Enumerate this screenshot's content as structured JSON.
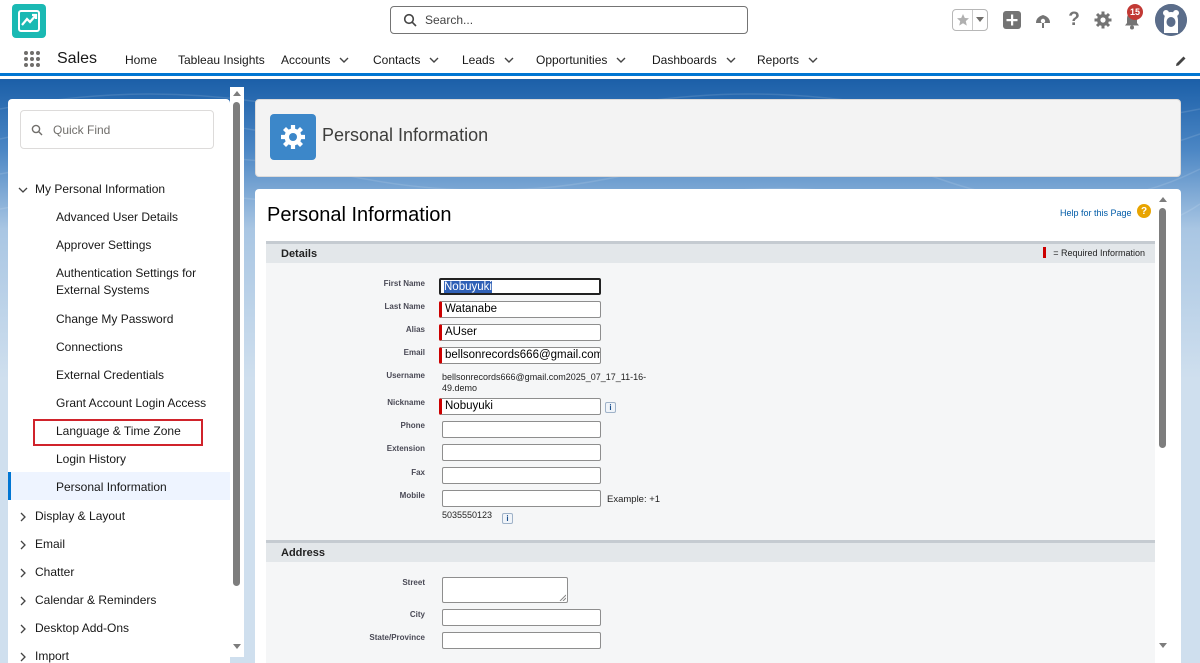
{
  "header": {
    "search_placeholder": "Search...",
    "notification_count": "15"
  },
  "nav": {
    "app_name": "Sales",
    "items": [
      {
        "label": "Home",
        "dropdown": false
      },
      {
        "label": "Tableau Insights",
        "dropdown": false
      },
      {
        "label": "Accounts",
        "dropdown": true
      },
      {
        "label": "Contacts",
        "dropdown": true
      },
      {
        "label": "Leads",
        "dropdown": true
      },
      {
        "label": "Opportunities",
        "dropdown": true
      },
      {
        "label": "Dashboards",
        "dropdown": true
      },
      {
        "label": "Reports",
        "dropdown": true
      }
    ]
  },
  "sidebar": {
    "quick_find_placeholder": "Quick Find",
    "section": "My Personal Information",
    "children": [
      "Advanced User Details",
      "Approver Settings",
      "Authentication Settings for External Systems",
      "Change My Password",
      "Connections",
      "External Credentials",
      "Grant Account Login Access",
      "Language & Time Zone",
      "Login History",
      "Personal Information"
    ],
    "collapsed_sections": [
      "Display & Layout",
      "Email",
      "Chatter",
      "Calendar & Reminders",
      "Desktop Add-Ons",
      "Import"
    ],
    "selected_item": "Personal Information",
    "highlighted_item": "Language & Time Zone"
  },
  "page_header": {
    "title": "Personal Information",
    "icon": "gear-icon"
  },
  "main": {
    "title": "Personal Information",
    "help_link": "Help for this Page",
    "details_section": {
      "title": "Details",
      "required_legend": "= Required Information",
      "fields": {
        "first_name": {
          "label": "First Name",
          "value": "Nobuyuki"
        },
        "last_name": {
          "label": "Last Name",
          "value": "Watanabe"
        },
        "alias": {
          "label": "Alias",
          "value": "AUser"
        },
        "email": {
          "label": "Email",
          "value": "bellsonrecords666@gmail.com"
        },
        "username": {
          "label": "Username",
          "value_line1": "bellsonrecords666@gmail.com2025_07_17_11-16-",
          "value_line2": "49.demo"
        },
        "nickname": {
          "label": "Nickname",
          "value": "Nobuyuki"
        },
        "phone": {
          "label": "Phone",
          "value": ""
        },
        "extension": {
          "label": "Extension",
          "value": ""
        },
        "fax": {
          "label": "Fax",
          "value": ""
        },
        "mobile": {
          "label": "Mobile",
          "value": "",
          "example": "Example: +1",
          "example_cont": "5035550123"
        }
      }
    },
    "address_section": {
      "title": "Address",
      "fields": {
        "street": {
          "label": "Street",
          "value": ""
        },
        "city": {
          "label": "City",
          "value": ""
        },
        "state": {
          "label": "State/Province",
          "value": ""
        }
      }
    }
  },
  "colors": {
    "brand_blue": "#0176d3",
    "app_logo": "#1ab9b3",
    "required_red": "#cc0000",
    "highlight_red": "#d0232b"
  }
}
